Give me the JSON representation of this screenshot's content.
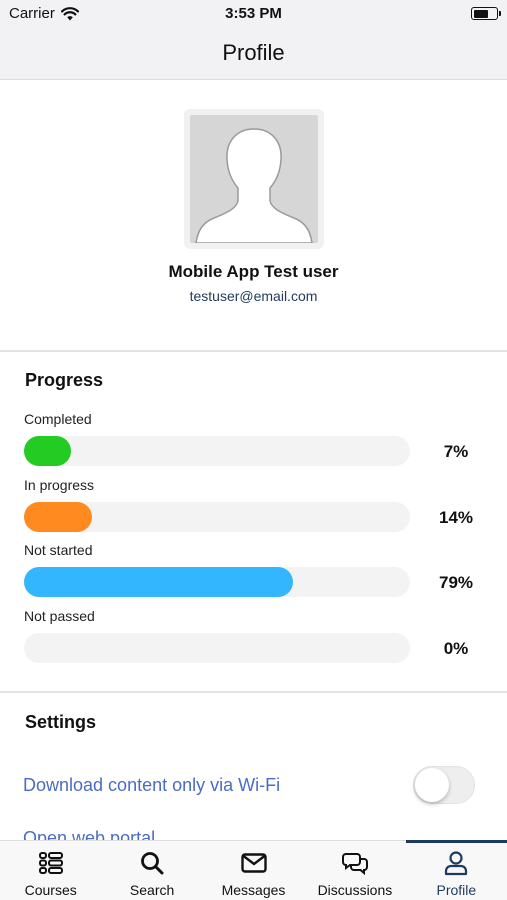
{
  "status_bar": {
    "carrier": "Carrier",
    "time": "3:53 PM",
    "battery_level": 0.6
  },
  "nav": {
    "title": "Profile"
  },
  "profile": {
    "name": "Mobile App Test user",
    "email": "testuser@email.com",
    "avatar_icon": "person-silhouette-icon"
  },
  "progress": {
    "title": "Progress",
    "items": [
      {
        "label": "Completed",
        "percent_text": "7%",
        "value": 0.07,
        "color": "#22cc22"
      },
      {
        "label": "In progress",
        "percent_text": "14%",
        "value": 0.14,
        "color": "#ff8a1f"
      },
      {
        "label": "Not started",
        "percent_text": "79%",
        "value": 0.79,
        "color": "#34b6ff"
      },
      {
        "label": "Not passed",
        "percent_text": "0%",
        "value": 0.0,
        "color": "#e5484d"
      }
    ]
  },
  "settings": {
    "title": "Settings",
    "wifi_label": "Download content only via Wi-Fi",
    "wifi_enabled": false,
    "portal_label": "Open web portal"
  },
  "tabs": [
    {
      "label": "Courses",
      "icon": "courses-list-icon",
      "active": false
    },
    {
      "label": "Search",
      "icon": "search-icon",
      "active": false
    },
    {
      "label": "Messages",
      "icon": "envelope-icon",
      "active": false
    },
    {
      "label": "Discussions",
      "icon": "chat-bubbles-icon",
      "active": false
    },
    {
      "label": "Profile",
      "icon": "person-icon",
      "active": true
    }
  ],
  "colors": {
    "accent": "#1e3a5f",
    "link": "#4a6cc4"
  }
}
